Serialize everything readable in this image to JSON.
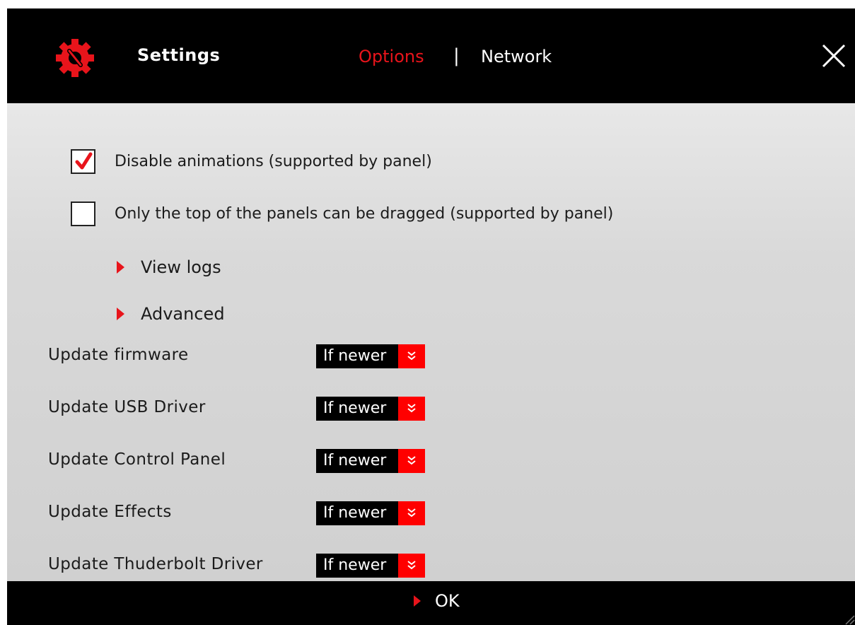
{
  "window": {
    "title": "Settings"
  },
  "tabs": {
    "options": "Options",
    "separator": "|",
    "network": "Network"
  },
  "options": {
    "disable_animations": {
      "label": "Disable animations (supported by panel)",
      "checked": true
    },
    "top_drag_only": {
      "label": "Only the top of the panels can be dragged (supported by panel)",
      "checked": false
    }
  },
  "expanders": {
    "view_logs": "View logs",
    "advanced": "Advanced"
  },
  "updates": [
    {
      "label": "Update firmware",
      "value": "If newer"
    },
    {
      "label": "Update USB Driver",
      "value": "If newer"
    },
    {
      "label": "Update Control Panel",
      "value": "If newer"
    },
    {
      "label": "Update Effects",
      "value": "If newer"
    },
    {
      "label": "Update Thuderbolt Driver",
      "value": "If newer"
    }
  ],
  "footer": {
    "ok_label": "OK"
  },
  "icons": {
    "app": "gear-wrench-icon",
    "close": "close-icon",
    "select": "double-chevron-down-icon"
  },
  "colors": {
    "accent": "#e8141b",
    "select_arrow": "#ff0000",
    "bar": "#000000"
  }
}
